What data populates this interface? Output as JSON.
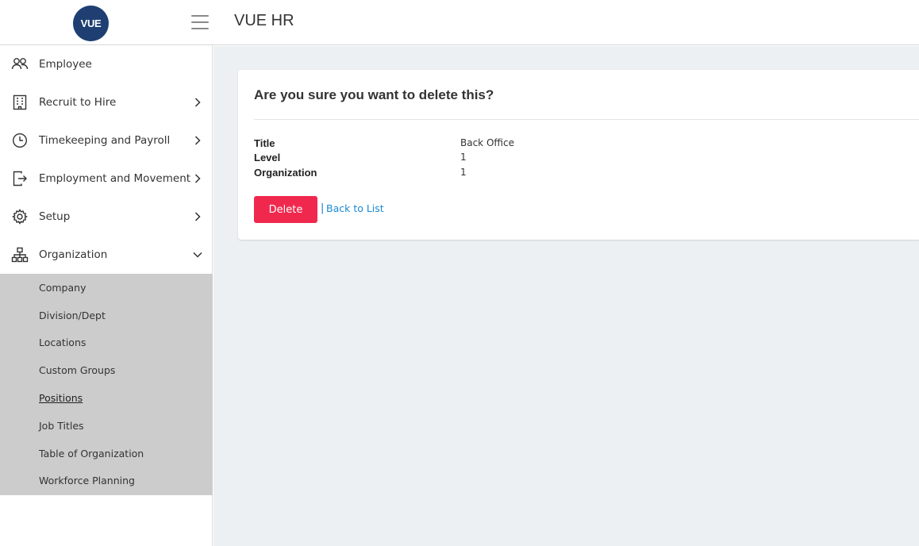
{
  "header": {
    "logo_text": "VUE",
    "app_title": "VUE HR"
  },
  "sidebar": {
    "items": [
      {
        "label": "Employee",
        "icon": "users-icon",
        "has_chevron": false
      },
      {
        "label": "Recruit to Hire",
        "icon": "building-icon",
        "has_chevron": true
      },
      {
        "label": "Timekeeping and Payroll",
        "icon": "clock-icon",
        "has_chevron": true
      },
      {
        "label": "Employment and Movement",
        "icon": "exit-icon",
        "has_chevron": true
      },
      {
        "label": "Setup",
        "icon": "gear-icon",
        "has_chevron": true
      },
      {
        "label": "Organization",
        "icon": "org-chart-icon",
        "has_chevron": true,
        "expanded": true
      }
    ],
    "submenu": [
      {
        "label": "Company"
      },
      {
        "label": "Division/Dept"
      },
      {
        "label": "Locations"
      },
      {
        "label": "Custom Groups"
      },
      {
        "label": "Positions",
        "active": true
      },
      {
        "label": "Job Titles"
      },
      {
        "label": "Table of Organization"
      },
      {
        "label": "Workforce Planning"
      }
    ]
  },
  "main": {
    "heading": "Are you sure you want to delete this?",
    "details": [
      {
        "label": "Title",
        "value": "Back Office"
      },
      {
        "label": "Level",
        "value": "1"
      },
      {
        "label": "Organization",
        "value": "1"
      }
    ],
    "delete_label": "Delete",
    "separator": "|",
    "back_label": "Back to List"
  },
  "colors": {
    "logo_bg": "#1f3f73",
    "delete_button": "#f0284e",
    "link": "#1a8ad4",
    "submenu_bg": "#cccccc",
    "main_bg": "#edf0f3"
  }
}
